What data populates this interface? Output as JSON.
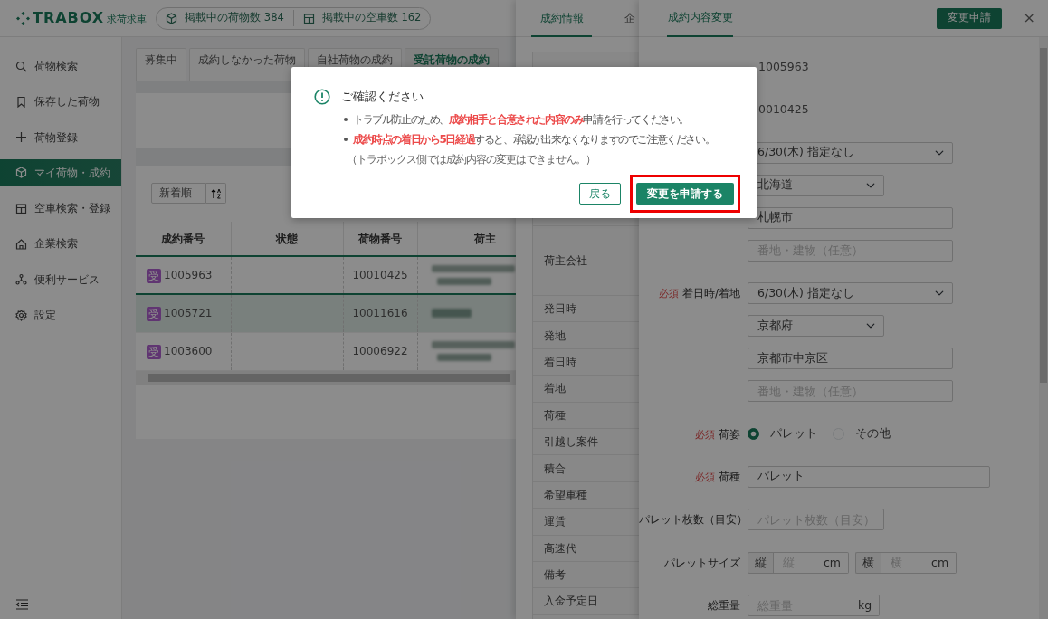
{
  "header": {
    "logo": "TRABOX",
    "logo_sub": "求荷求車",
    "stats": [
      {
        "label": "掲載中の荷物数 384"
      },
      {
        "label": "掲載中の空車数 162"
      }
    ]
  },
  "sidebar": {
    "items": [
      {
        "label": "荷物検索",
        "selected": false
      },
      {
        "label": "保存した荷物",
        "selected": false
      },
      {
        "label": "荷物登録",
        "selected": false
      },
      {
        "label": "マイ荷物・成約",
        "selected": true
      },
      {
        "label": "空車検索・登録",
        "selected": false
      },
      {
        "label": "企業検索",
        "selected": false
      },
      {
        "label": "便利サービス",
        "selected": false
      },
      {
        "label": "設定",
        "selected": false
      }
    ]
  },
  "main": {
    "tabs": [
      {
        "label": "募集中",
        "selected": false
      },
      {
        "label": "成約しなかった荷物",
        "selected": false
      },
      {
        "label": "自社荷物の成約",
        "selected": false
      },
      {
        "label": "受託荷物の成約",
        "selected": true
      }
    ],
    "sort": {
      "value": "新着順"
    },
    "table": {
      "columns": [
        "成約番号",
        "状態",
        "荷物番号",
        "荷主"
      ],
      "rows": [
        {
          "badge": "受",
          "deal_no": "1005963",
          "cargo_no": "10010425",
          "selected": false
        },
        {
          "badge": "受",
          "deal_no": "1005721",
          "cargo_no": "10011616",
          "selected": true
        },
        {
          "badge": "受",
          "deal_no": "1003600",
          "cargo_no": "10006922",
          "selected": false
        }
      ]
    }
  },
  "deal_panel": {
    "tabs": [
      {
        "label": "成約情報",
        "selected": true
      },
      {
        "label": "企",
        "selected": false
      }
    ],
    "labels": [
      "荷主会社",
      "発日時",
      "発地",
      "着日時",
      "着地",
      "荷種",
      "引越し案件",
      "積合",
      "希望車種",
      "運賃",
      "高速代",
      "備考",
      "入金予定日"
    ]
  },
  "edit_panel": {
    "tabs": [
      {
        "label": "成約内容変更",
        "selected": true
      }
    ],
    "submit": "変更申請",
    "close": "×",
    "groups": [
      {
        "controls": [
          {
            "kind": "value",
            "value": "1005963"
          }
        ]
      },
      {
        "controls": [
          {
            "kind": "value",
            "value": "0010425"
          }
        ]
      },
      {
        "controls": [
          {
            "kind": "date",
            "value": "6/30(木) 指定なし"
          },
          {
            "kind": "prefecture",
            "value": "北海道"
          },
          {
            "kind": "city",
            "value": "札幌市"
          },
          {
            "kind": "address",
            "placeholder": "番地・建物（任意）"
          }
        ]
      },
      {
        "required_mark": "必須",
        "label": "着日時/着地",
        "controls": [
          {
            "kind": "date",
            "value": "6/30(木) 指定なし"
          },
          {
            "kind": "prefecture",
            "value": "京都府"
          },
          {
            "kind": "city",
            "value": "京都市中京区"
          },
          {
            "kind": "address",
            "placeholder": "番地・建物（任意）"
          }
        ]
      },
      {
        "required_mark": "必須",
        "label": "荷姿",
        "controls": [
          {
            "kind": "radio",
            "options": [
              {
                "label": "パレット",
                "selected": true
              },
              {
                "label": "その他",
                "selected": false
              }
            ]
          }
        ]
      },
      {
        "required_mark": "必須",
        "label": "荷種",
        "controls": [
          {
            "kind": "cargo",
            "value": "パレット"
          }
        ]
      },
      {
        "label": "パレット枚数（目安）",
        "controls": [
          {
            "kind": "count",
            "placeholder": "パレット枚数（目安）"
          }
        ]
      },
      {
        "label": "パレットサイズ",
        "controls": [
          {
            "kind": "size",
            "parts": [
              {
                "prefix": "縦",
                "placeholder": "縦",
                "unit": "cm"
              },
              {
                "prefix": "横",
                "placeholder": "横",
                "unit": "cm"
              }
            ]
          }
        ]
      },
      {
        "label": "総重量",
        "controls": [
          {
            "kind": "weight",
            "placeholder": "総重量",
            "unit": "kg"
          }
        ]
      }
    ]
  },
  "dialog": {
    "title": "ご確認ください",
    "bullets": [
      "トラブル防止のため、**成約相手と合意された内容のみ**申請を行ってください。",
      "**成約時点の着日から5日経過**すると、承認が出来なくなりますのでご注意ください。"
    ],
    "note": "（トラボックス側では成約内容の変更はできません。）",
    "buttons": [
      {
        "label": "戻る",
        "kind": "secondary",
        "highlighted": false
      },
      {
        "label": "変更を申請する",
        "kind": "primary",
        "highlighted": true
      }
    ]
  }
}
